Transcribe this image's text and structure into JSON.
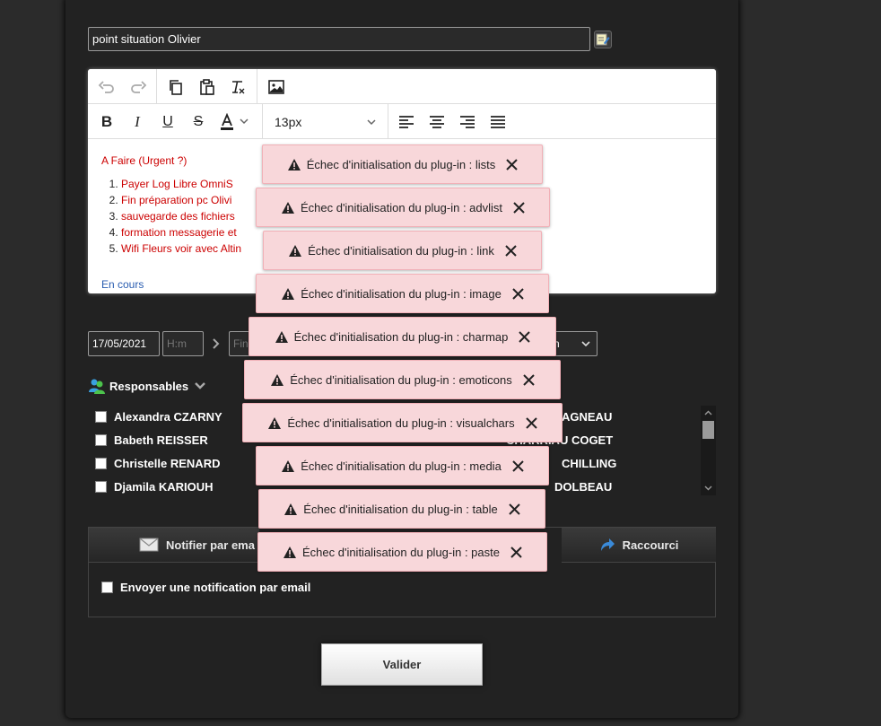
{
  "form": {
    "subject_value": "point situation Olivier",
    "editor": {
      "font_size": "13px",
      "heading": "A Faire (Urgent ?)",
      "items": [
        "Payer Log Libre OmniS",
        "Fin préparation pc Olivi",
        "sauvegarde des fichiers",
        "formation messagerie et",
        "Wifi Fleurs voir avec Altin"
      ],
      "status": "En cours"
    },
    "date_start": "17/05/2021",
    "time_placeholder": "H:m",
    "end_placeholder": "Fin",
    "select_partial": "n",
    "responsables_label": "Responsables",
    "people_col1": [
      "Alexandra CZARNY",
      "Babeth REISSER",
      "Christelle RENARD",
      "Djamila KARIOUH"
    ],
    "people_col3": [
      "AGNEAU",
      "CHARRIAU COGET",
      "CHILLING",
      "DOLBEAU"
    ],
    "tabs": {
      "notify": "Notifier par ema",
      "shortcut": "Raccourci"
    },
    "notify_email_label": "Envoyer une notification par email",
    "validate_label": "Valider"
  },
  "errors": [
    "Échec d'initialisation du plug-in : lists",
    "Échec d'initialisation du plug-in : advlist",
    "Échec d'initialisation du plug-in : link",
    "Échec d'initialisation du plug-in : image",
    "Échec d'initialisation du plug-in : charmap",
    "Échec d'initialisation du plug-in : emoticons",
    "Échec d'initialisation du plug-in : visualchars",
    "Échec d'initialisation du plug-in : media",
    "Échec d'initialisation du plug-in : table",
    "Échec d'initialisation du plug-in : paste"
  ],
  "colors": {
    "toast_bg": "#f8d7da",
    "red_text": "#cc0000",
    "link_blue": "#2a5db0"
  }
}
